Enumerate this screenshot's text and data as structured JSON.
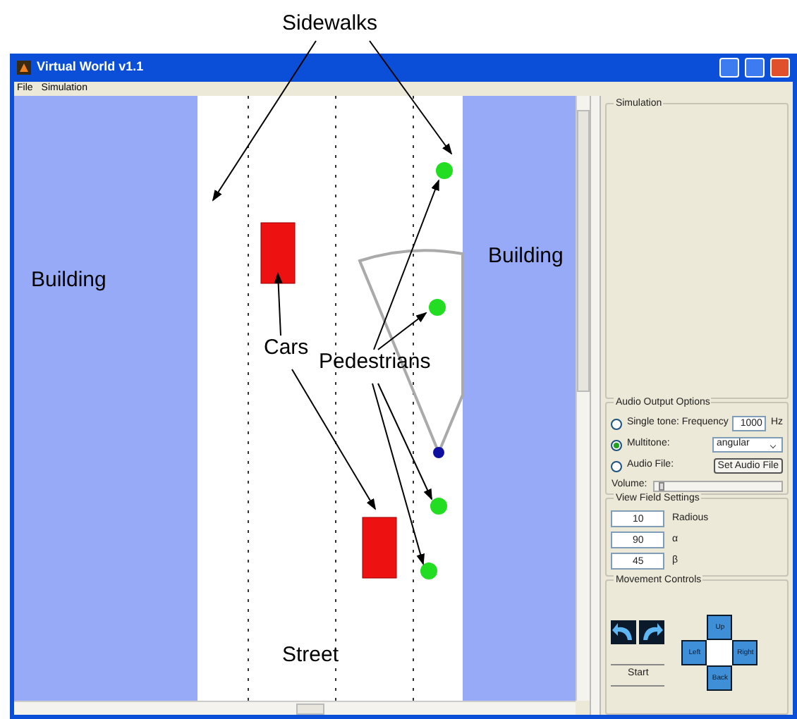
{
  "annotations": [
    {
      "text": "Sidewalks"
    },
    {
      "text": "Building"
    },
    {
      "text": "Building"
    },
    {
      "text": "Cars"
    },
    {
      "text": "Pedestrians"
    },
    {
      "text": "Street"
    }
  ],
  "window": {
    "title": "Virtual World v1.1"
  },
  "menu": [
    "File",
    "Simulation"
  ],
  "panel": {
    "simulation": {
      "title": "Simulation"
    },
    "audio": {
      "title": "Audio Output Options",
      "options": [
        {
          "label": "Single tone: Frequency",
          "selected": false
        },
        {
          "label": "Multitone:",
          "selected": true
        },
        {
          "label": "Audio File:",
          "selected": false
        }
      ],
      "frequency": "1000",
      "frequency_unit": "Hz",
      "dropdown": "angular",
      "file_button": "Set Audio File",
      "volume_label": "Volume:",
      "volume": {
        "level": 0.04
      }
    },
    "view_field": {
      "title": "View Field Settings",
      "fields": [
        {
          "value": "10",
          "label": "Radious"
        },
        {
          "value": "90",
          "label": "α"
        },
        {
          "value": "45",
          "label": "β"
        }
      ]
    },
    "movement": {
      "title": "Movement Controls",
      "start": "Start",
      "pad": [
        "Up",
        "Left",
        "Right",
        "Back"
      ]
    }
  }
}
